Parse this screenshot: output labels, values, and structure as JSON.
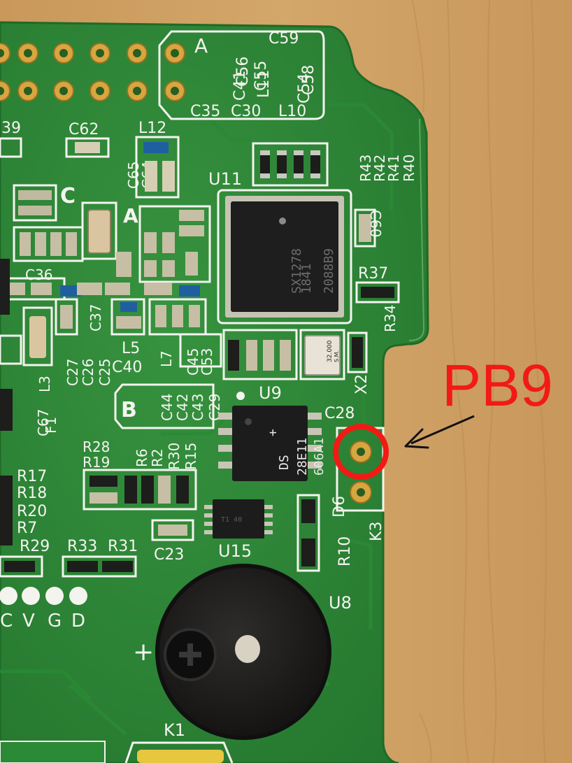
{
  "annotation": {
    "label": "PB9",
    "color": "#f21a14"
  },
  "silkscreen": {
    "section_a": "A",
    "section_b": "B",
    "section_c": "C",
    "top_refs": [
      "C59",
      "C56",
      "C58",
      "C55",
      "C41",
      "C54",
      "L11",
      "C35",
      "C30",
      "L10"
    ],
    "upper_row": [
      "39",
      "C62",
      "L12",
      "C65",
      "C64"
    ],
    "resistors_top": [
      "R43",
      "R42",
      "R41",
      "R40"
    ],
    "u11": "U11",
    "c60": "C60",
    "r37": "R37",
    "r34": "R34",
    "x2": "X2",
    "crystal_text": [
      "32.000",
      "S.M."
    ],
    "c36": "C36",
    "c37": "C37",
    "col_caps": [
      "C27",
      "C26",
      "C25",
      "C40",
      "C45",
      "C53"
    ],
    "l_labels": [
      "L3",
      "L5",
      "L7"
    ],
    "u9": "U9",
    "c28": "C28",
    "b_caps": [
      "C44",
      "C42",
      "C43",
      "C29"
    ],
    "r_mid": [
      "R28",
      "R19",
      "R6",
      "R2",
      "R30",
      "R15"
    ],
    "r_left": [
      "R17",
      "R18",
      "R20",
      "R7"
    ],
    "c67": "C67",
    "f1": "F1",
    "r_bottom": [
      "R29",
      "R33",
      "R31"
    ],
    "c23": "C23",
    "u15": "U15",
    "r10": "R10",
    "d6": "D6",
    "k3": "K3",
    "u8": "U8",
    "k1": "K1",
    "plus": "+",
    "header_pins": [
      "C",
      "V",
      "G",
      "D"
    ]
  },
  "chip_markings": {
    "u11": [
      "SX1278",
      "1841",
      "2088B9"
    ],
    "u9": [
      "DS",
      "28E11",
      "606A1"
    ],
    "u9_plus": "+",
    "u15": "T1 40"
  }
}
